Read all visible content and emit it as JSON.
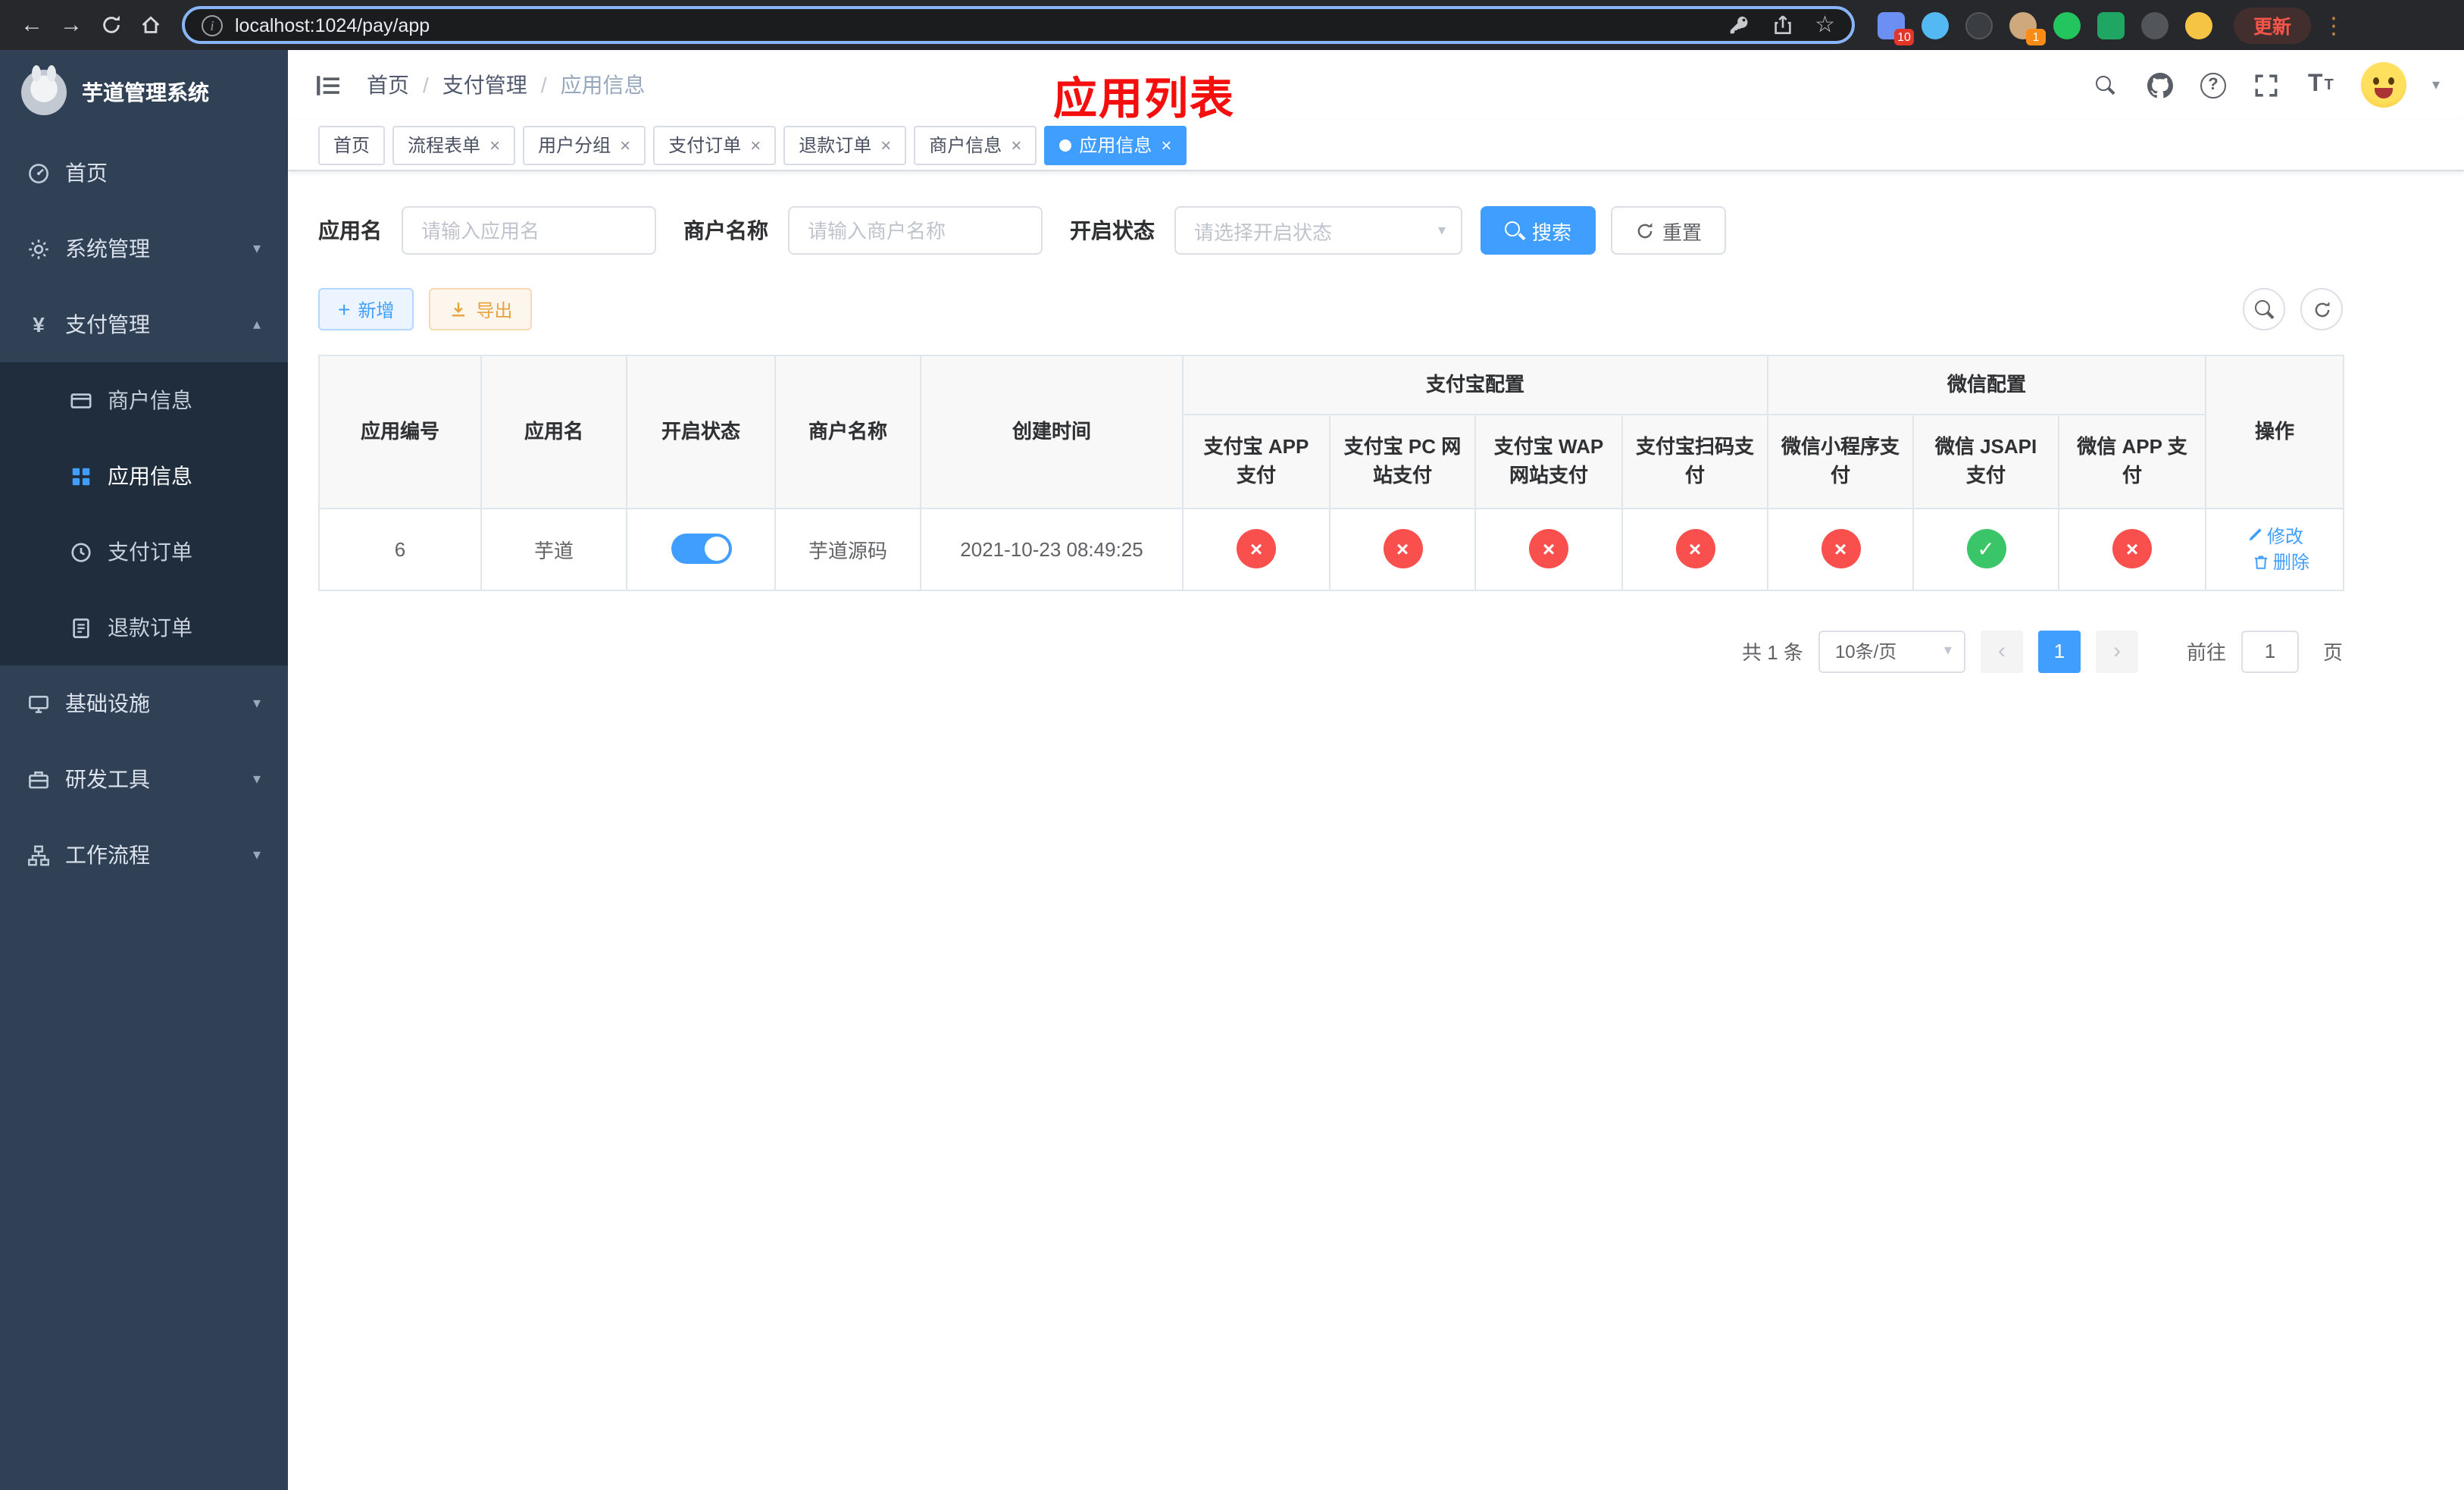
{
  "colors": {
    "accent": "#409eff",
    "success": "#3ac569",
    "danger": "#f9504e",
    "warning": "#e6a23c",
    "annotation": "#f40f0f",
    "sidebar-bg": "#304156",
    "submenu-bg": "#1f2d3d"
  },
  "browser": {
    "url": "localhost:1024/pay/app",
    "update_label": "更新",
    "ext_badge_blue": "10",
    "ext_badge_avatar": "1"
  },
  "sidebar": {
    "title": "芋道管理系统",
    "items": [
      {
        "label": "首页"
      },
      {
        "label": "系统管理"
      },
      {
        "label": "支付管理"
      },
      {
        "label": "基础设施"
      },
      {
        "label": "研发工具"
      },
      {
        "label": "工作流程"
      }
    ],
    "payment_children": [
      {
        "label": "商户信息"
      },
      {
        "label": "应用信息"
      },
      {
        "label": "支付订单"
      },
      {
        "label": "退款订单"
      }
    ]
  },
  "header": {
    "breadcrumb": [
      "首页",
      "支付管理",
      "应用信息"
    ],
    "annotation": "应用列表"
  },
  "tabs": [
    {
      "label": "首页"
    },
    {
      "label": "流程表单"
    },
    {
      "label": "用户分组"
    },
    {
      "label": "支付订单"
    },
    {
      "label": "退款订单"
    },
    {
      "label": "商户信息"
    },
    {
      "label": "应用信息"
    }
  ],
  "filters": {
    "app_name_label": "应用名",
    "app_name_placeholder": "请输入应用名",
    "merchant_label": "商户名称",
    "merchant_placeholder": "请输入商户名称",
    "status_label": "开启状态",
    "status_placeholder": "请选择开启状态",
    "search_label": "搜索",
    "reset_label": "重置"
  },
  "toolbar": {
    "add_label": "新增",
    "export_label": "导出"
  },
  "table": {
    "yes_glyph": "✓",
    "no_glyph": "×",
    "columns": {
      "app_id": "应用编号",
      "app_name": "应用名",
      "status": "开启状态",
      "merchant": "商户名称",
      "created": "创建时间",
      "alipay_group": "支付宝配置",
      "wechat_group": "微信配置",
      "actions": "操作"
    },
    "subcolumns": [
      "支付宝 APP 支付",
      "支付宝 PC 网站支付",
      "支付宝 WAP 网站支付",
      "支付宝扫码支付",
      "微信小程序支付",
      "微信 JSAPI 支付",
      "微信 APP 支付"
    ],
    "row": {
      "id": "6",
      "name": "芋道",
      "enabled": true,
      "merchant": "芋道源码",
      "created": "2021-10-23 08:49:25",
      "configs": [
        false,
        false,
        false,
        false,
        false,
        true,
        false
      ],
      "edit_label": "修改",
      "delete_label": "删除"
    }
  },
  "pagination": {
    "total": "共 1 条",
    "page_size": "10条/页",
    "current_page": "1",
    "goto_prefix": "前往",
    "goto_value": "1",
    "goto_suffix": "页"
  }
}
